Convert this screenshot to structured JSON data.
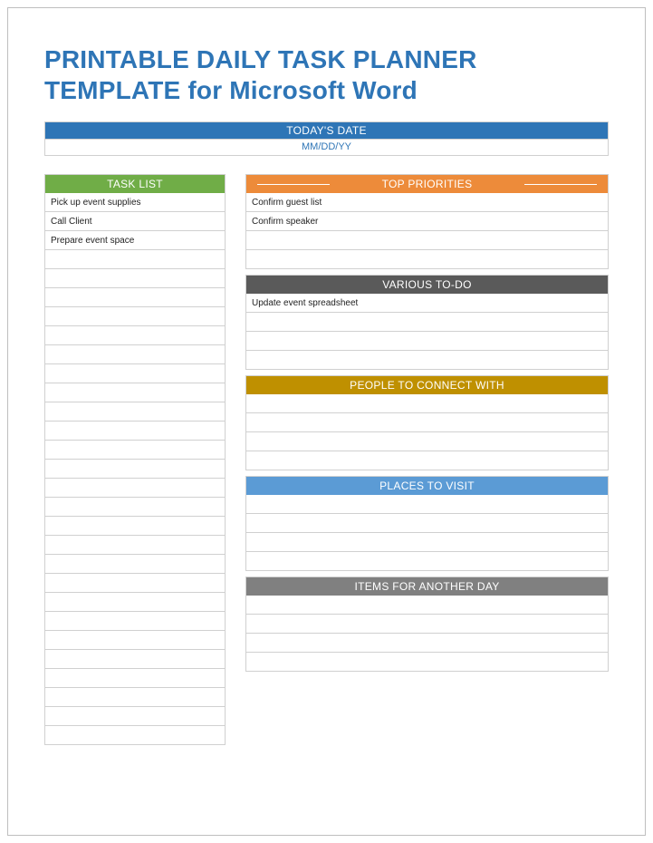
{
  "title_line1": "PRINTABLE DAILY TASK PLANNER",
  "title_line2": "TEMPLATE for Microsoft Word",
  "date_section": {
    "header": "TODAY'S DATE",
    "placeholder": "MM/DD/YY"
  },
  "task_list": {
    "header": "TASK LIST",
    "rows": [
      "Pick up event supplies",
      "Call Client",
      "Prepare event space",
      "",
      "",
      "",
      "",
      "",
      "",
      "",
      "",
      "",
      "",
      "",
      "",
      "",
      "",
      "",
      "",
      "",
      "",
      "",
      "",
      "",
      "",
      "",
      "",
      "",
      ""
    ]
  },
  "top_priorities": {
    "header": "TOP PRIORITIES",
    "rows": [
      "Confirm guest list",
      "Confirm speaker",
      "",
      ""
    ]
  },
  "various_todo": {
    "header": "VARIOUS TO-DO",
    "rows": [
      "Update event spreadsheet",
      "",
      "",
      ""
    ]
  },
  "people_connect": {
    "header": "PEOPLE TO CONNECT WITH",
    "rows": [
      "",
      "",
      "",
      ""
    ]
  },
  "places_visit": {
    "header": "PLACES TO VISIT",
    "rows": [
      "",
      "",
      "",
      ""
    ]
  },
  "items_another_day": {
    "header": "ITEMS FOR ANOTHER DAY",
    "rows": [
      "",
      "",
      "",
      ""
    ]
  }
}
